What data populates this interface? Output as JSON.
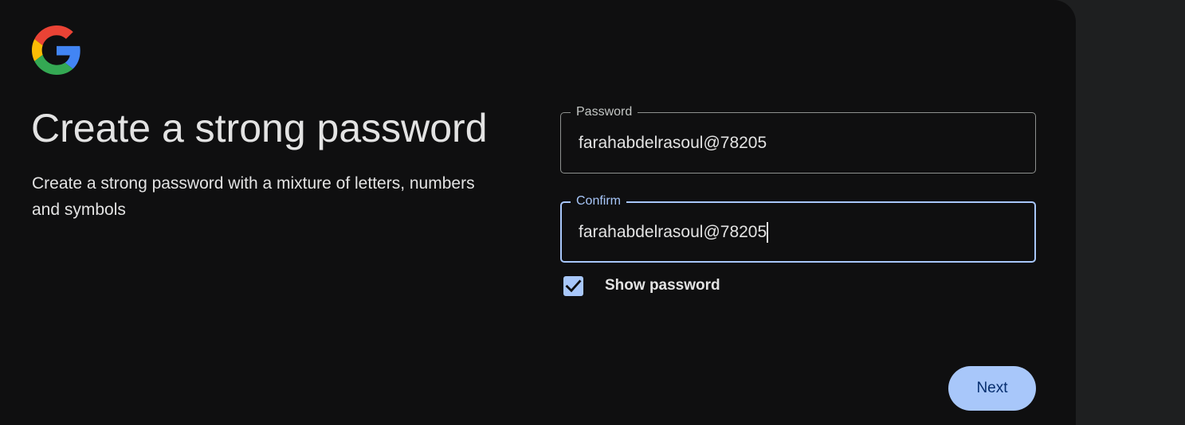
{
  "logo": {
    "icon": "google-g-icon",
    "colors": {
      "blue": "#4285F4",
      "red": "#EA4335",
      "yellow": "#FBBC05",
      "green": "#34A853"
    }
  },
  "heading": {
    "title": "Create a strong password",
    "subtitle": "Create a strong password with a mixture of letters, numbers and symbols"
  },
  "form": {
    "password": {
      "label": "Password",
      "value": "farahabdelrasoul@78205"
    },
    "confirm": {
      "label": "Confirm",
      "value": "farahabdelrasoul@78205",
      "focused": true
    },
    "show_password": {
      "label": "Show password",
      "checked": true,
      "icon": "checkmark-icon"
    }
  },
  "actions": {
    "next_label": "Next"
  },
  "theme": {
    "background": "#0f0f10",
    "accent": "#a8c7fa",
    "text": "#e3e3e3",
    "button_text": "#062e6f"
  }
}
